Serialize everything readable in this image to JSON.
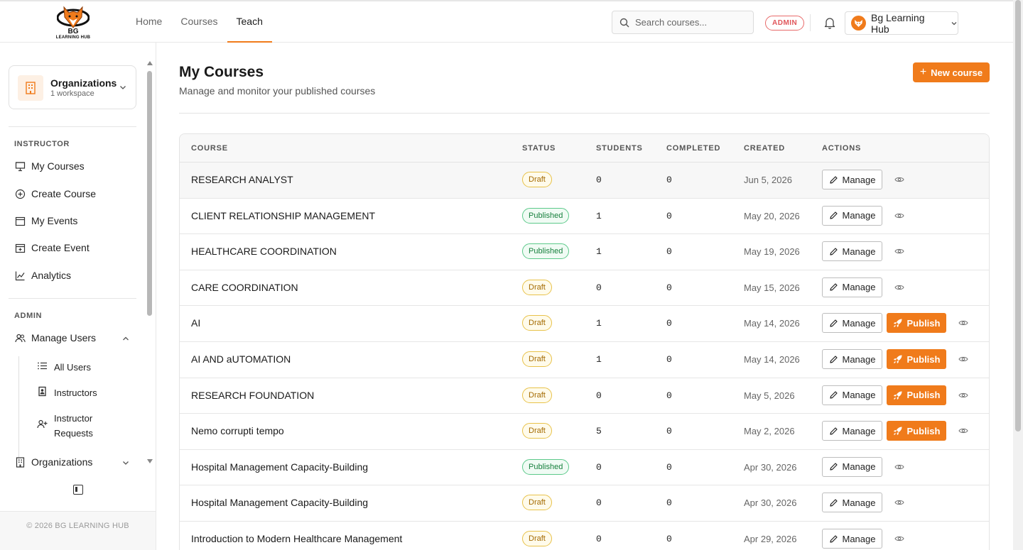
{
  "brand": {
    "logo_text": "BG",
    "logo_subtext": "LEARNING HUB"
  },
  "nav": {
    "items": [
      {
        "label": "Home"
      },
      {
        "label": "Courses"
      },
      {
        "label": "Teach"
      }
    ],
    "active": "Teach"
  },
  "search": {
    "placeholder": "Search courses..."
  },
  "header": {
    "role_badge": "ADMIN",
    "account_name": "Bg Learning Hub"
  },
  "sidebar": {
    "org_card": {
      "title": "Organizations",
      "subtitle": "1 workspace"
    },
    "instructor_heading": "INSTRUCTOR",
    "instructor_items": [
      {
        "label": "My Courses",
        "icon": "presentation-icon"
      },
      {
        "label": "Create Course",
        "icon": "plus-circle-icon"
      },
      {
        "label": "My Events",
        "icon": "calendar-icon"
      },
      {
        "label": "Create Event",
        "icon": "calendar-plus-icon"
      },
      {
        "label": "Analytics",
        "icon": "chart-line-icon"
      }
    ],
    "admin_heading": "ADMIN",
    "manage_users": "Manage Users",
    "admin_sub_items": [
      {
        "label": "All Users",
        "icon": "list-icon"
      },
      {
        "label": "Instructors",
        "icon": "id-badge-icon"
      },
      {
        "label": "Instructor Requests",
        "icon": "user-plus-icon"
      }
    ],
    "organizations": "Organizations",
    "footer": "© 2026 BG LEARNING HUB"
  },
  "main": {
    "title": "My Courses",
    "subtitle": "Manage and monitor your published courses",
    "new_course_label": "New course",
    "columns": {
      "course": "COURSE",
      "status": "STATUS",
      "students": "STUDENTS",
      "completed": "COMPLETED",
      "created": "CREATED",
      "actions": "ACTIONS"
    },
    "manage_label": "Manage",
    "publish_label": "Publish",
    "rows": [
      {
        "title": "RESEARCH ANALYST",
        "status": "Draft",
        "students": "0",
        "completed": "0",
        "created": "Jun 5, 2026",
        "publish": false
      },
      {
        "title": "CLIENT RELATIONSHIP MANAGEMENT",
        "status": "Published",
        "students": "1",
        "completed": "0",
        "created": "May 20, 2026",
        "publish": false
      },
      {
        "title": "HEALTHCARE COORDINATION",
        "status": "Published",
        "students": "1",
        "completed": "0",
        "created": "May 19, 2026",
        "publish": false
      },
      {
        "title": "CARE COORDINATION",
        "status": "Draft",
        "students": "0",
        "completed": "0",
        "created": "May 15, 2026",
        "publish": false
      },
      {
        "title": "AI",
        "status": "Draft",
        "students": "1",
        "completed": "0",
        "created": "May 14, 2026",
        "publish": true
      },
      {
        "title": "AI AND aUTOMATION",
        "status": "Draft",
        "students": "1",
        "completed": "0",
        "created": "May 14, 2026",
        "publish": true
      },
      {
        "title": "RESEARCH FOUNDATION",
        "status": "Draft",
        "students": "0",
        "completed": "0",
        "created": "May 5, 2026",
        "publish": true
      },
      {
        "title": "Nemo corrupti tempo",
        "status": "Draft",
        "students": "5",
        "completed": "0",
        "created": "May 2, 2026",
        "publish": true
      },
      {
        "title": "Hospital Management Capacity-Building",
        "status": "Published",
        "students": "0",
        "completed": "0",
        "created": "Apr 30, 2026",
        "publish": false
      },
      {
        "title": "Hospital Management Capacity-Building",
        "status": "Draft",
        "students": "0",
        "completed": "0",
        "created": "Apr 30, 2026",
        "publish": false
      },
      {
        "title": "Introduction to Modern Healthcare Management",
        "status": "Draft",
        "students": "0",
        "completed": "0",
        "created": "Apr 29, 2026",
        "publish": false
      }
    ]
  },
  "colors": {
    "accent": "#f07b1b",
    "draft": "#a46a00",
    "published": "#17803d",
    "admin_badge": "#e0555a"
  }
}
